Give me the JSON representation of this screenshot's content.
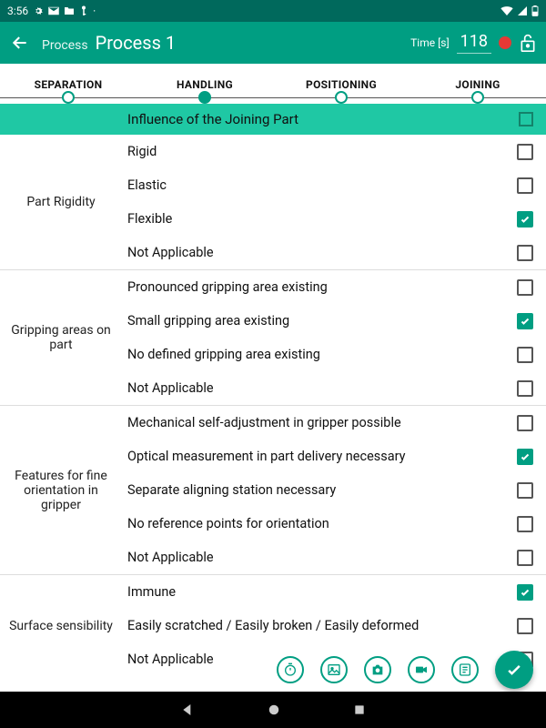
{
  "status": {
    "time": "3:56"
  },
  "appbar": {
    "back_icon": "back-icon",
    "label": "Process",
    "title": "Process 1",
    "time_label": "Time [s]",
    "time_value": "118"
  },
  "stepper": {
    "steps": [
      "SEPARATION",
      "HANDLING",
      "POSITIONING",
      "JOINING"
    ],
    "active_index": 1
  },
  "section": {
    "title": "Influence of the Joining Part",
    "checked": false
  },
  "groups": [
    {
      "label": "Part Rigidity",
      "items": [
        {
          "label": "Rigid",
          "checked": false
        },
        {
          "label": "Elastic",
          "checked": false
        },
        {
          "label": "Flexible",
          "checked": true
        },
        {
          "label": "Not Applicable",
          "checked": false
        }
      ]
    },
    {
      "label": "Gripping areas on part",
      "items": [
        {
          "label": "Pronounced gripping area existing",
          "checked": false
        },
        {
          "label": "Small gripping area existing",
          "checked": true
        },
        {
          "label": "No defined gripping area existing",
          "checked": false
        },
        {
          "label": "Not Applicable",
          "checked": false
        }
      ]
    },
    {
      "label": "Features for fine orientation in gripper",
      "items": [
        {
          "label": "Mechanical self-adjustment in gripper possible",
          "checked": false
        },
        {
          "label": "Optical measurement in part delivery necessary",
          "checked": true
        },
        {
          "label": "Separate aligning station necessary",
          "checked": false
        },
        {
          "label": "No reference points for orientation",
          "checked": false
        },
        {
          "label": "Not Applicable",
          "checked": false
        }
      ]
    },
    {
      "label": "Surface sensibility",
      "items": [
        {
          "label": "Immune",
          "checked": true
        },
        {
          "label": "Easily scratched / Easily broken / Easily deformed",
          "checked": false
        },
        {
          "label": "Not Applicable",
          "checked": false
        }
      ]
    }
  ],
  "bottom_icons": [
    "timer-icon",
    "image-icon",
    "camera-icon",
    "video-icon",
    "note-icon"
  ],
  "colors": {
    "primary": "#009e82",
    "primary_dark": "#00695c",
    "accent": "#1fc8a4"
  }
}
